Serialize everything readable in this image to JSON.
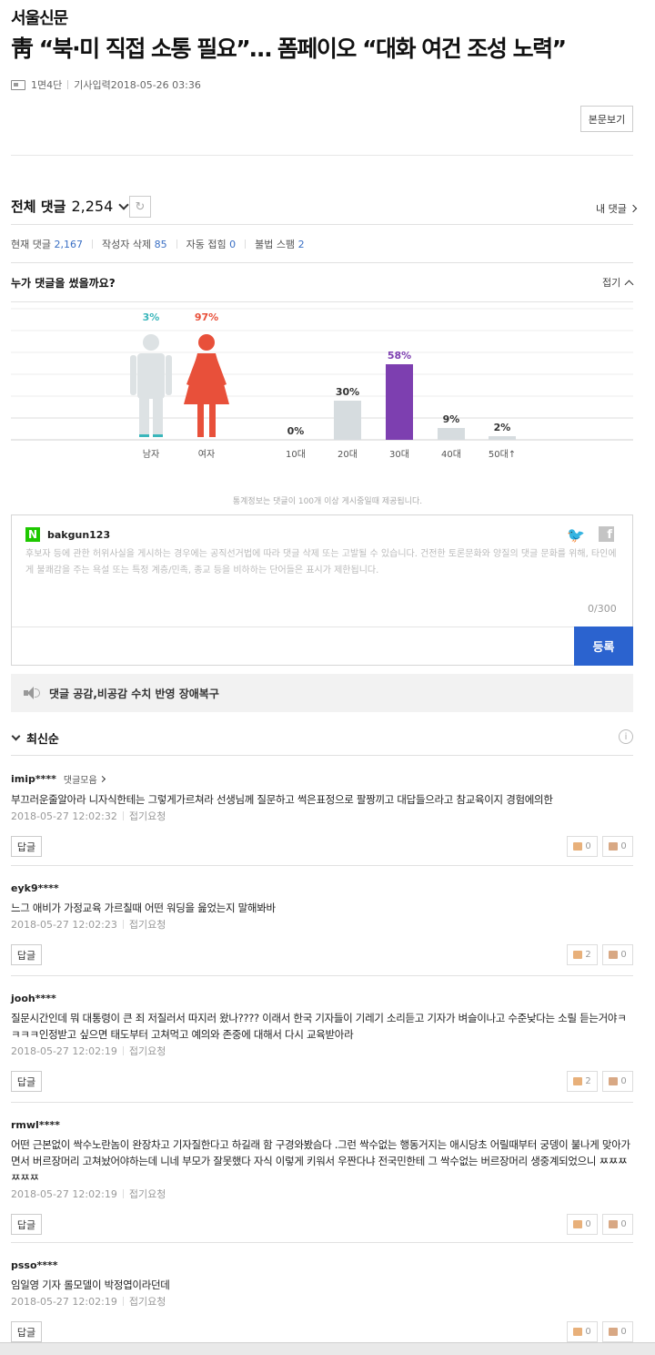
{
  "header": {
    "brand": "서울신문",
    "headline": "靑 “북·미 직접 소통 필요”… 폼페이오 “대화 여건 조성 노력”",
    "page_info": "1면4단",
    "date_label": "기사입력2018-05-26 03:36",
    "view_button": "본문보기"
  },
  "comments_header": {
    "title": "전체 댓글",
    "total": "2,254",
    "my_comments": "내 댓글",
    "stats": [
      {
        "label": "현재 댓글",
        "value": "2,167"
      },
      {
        "label": "작성자 삭제",
        "value": "85"
      },
      {
        "label": "자동 접힘",
        "value": "0"
      },
      {
        "label": "불법 스팸",
        "value": "2"
      }
    ]
  },
  "who_section": {
    "title": "누가 댓글을 썼을까요?",
    "fold_label": "접기",
    "note": "통계정보는 댓글이 100개 이상 게시중일때 제공됩니다."
  },
  "chart_data": {
    "type": "bar",
    "gender": {
      "categories": [
        "남자",
        "여자"
      ],
      "values": [
        3,
        97
      ],
      "labels": [
        "3%",
        "97%"
      ],
      "colors": [
        "#3ab6bb",
        "#e8503a"
      ]
    },
    "age": {
      "categories": [
        "10대",
        "20대",
        "30대",
        "40대",
        "50대↑"
      ],
      "values": [
        0,
        30,
        58,
        9,
        2
      ],
      "labels": [
        "0%",
        "30%",
        "58%",
        "9%",
        "2%"
      ],
      "highlight_color": "#7d3fb0",
      "base_color": "#d6dcdf"
    },
    "ylim": [
      0,
      100
    ],
    "grid": true
  },
  "write": {
    "username": "bakgun123",
    "placeholder": "후보자 등에 관한 허위사실을 게시하는 경우에는 공직선거법에 따라 댓글 삭제 또는 고발될 수 있습니다. 건전한 토론문화와 양질의 댓글 문화를 위해, 타인에게 불쾌감을 주는 욕설 또는 특정 계층/민족, 종교 등을 비하하는 단어들은 표시가 제한됩니다.",
    "char_count": "0/300",
    "submit": "등록"
  },
  "notice": "댓글 공감,비공감 수치 반영 장애복구",
  "sort_label": "최신순",
  "comment_ui": {
    "more_label": "댓글모음",
    "report_label": "접기요청",
    "reply_label": "답글"
  },
  "comments": [
    {
      "user": "imip****",
      "show_more": true,
      "text": "부끄러운줄알아라 니자식한테는 그렇게가르쳐라 선생님께 질문하고 썩은표정으로 팔짱끼고 대답들으라고 참교육이지 경험에의한",
      "date": "2018-05-27 12:02:32",
      "likes": "0",
      "dislikes": "0"
    },
    {
      "user": "eyk9****",
      "show_more": false,
      "text": "느그 애비가 가정교육 가르칠때 어떤 워딩을 읊었는지 말해봐바",
      "date": "2018-05-27 12:02:23",
      "likes": "2",
      "dislikes": "0"
    },
    {
      "user": "jooh****",
      "show_more": false,
      "text": "질문시간인데 뭐 대통령이 큰 죄 저질러서 따지러 왔나???? 이래서 한국 기자들이 기레기 소리듣고 기자가 벼슬이나고 수준낮다는 소릴 듣는거야ㅋㅋㅋㅋ인정받고 싶으면 태도부터 고쳐먹고 예의와 존중에 대해서 다시 교육받아라",
      "date": "2018-05-27 12:02:19",
      "likes": "2",
      "dislikes": "0"
    },
    {
      "user": "rmwl****",
      "show_more": false,
      "text": "어떤 근본없이 싹수노란놈이 완장차고 기자질한다고 하길래 함 구경와봤슴다 .그런 싹수없는 행동거지는 애시당초 어릴때부터 궁뎅이 불나게 맞아가면서 버르장머리 고쳐놨어야하는데 니네 부모가 잘못했다 자식 이렇게 키워서 우짠다냐 전국민한테 그 싹수없는 버르장머리 생중계되었으니 ㅉㅉㅉㅉㅉㅉ",
      "date": "2018-05-27 12:02:19",
      "likes": "0",
      "dislikes": "0"
    },
    {
      "user": "psso****",
      "show_more": false,
      "text": "임일영 기자 롤모델이 박정엽이라던데",
      "date": "2018-05-27 12:02:19",
      "likes": "0",
      "dislikes": "0"
    }
  ]
}
